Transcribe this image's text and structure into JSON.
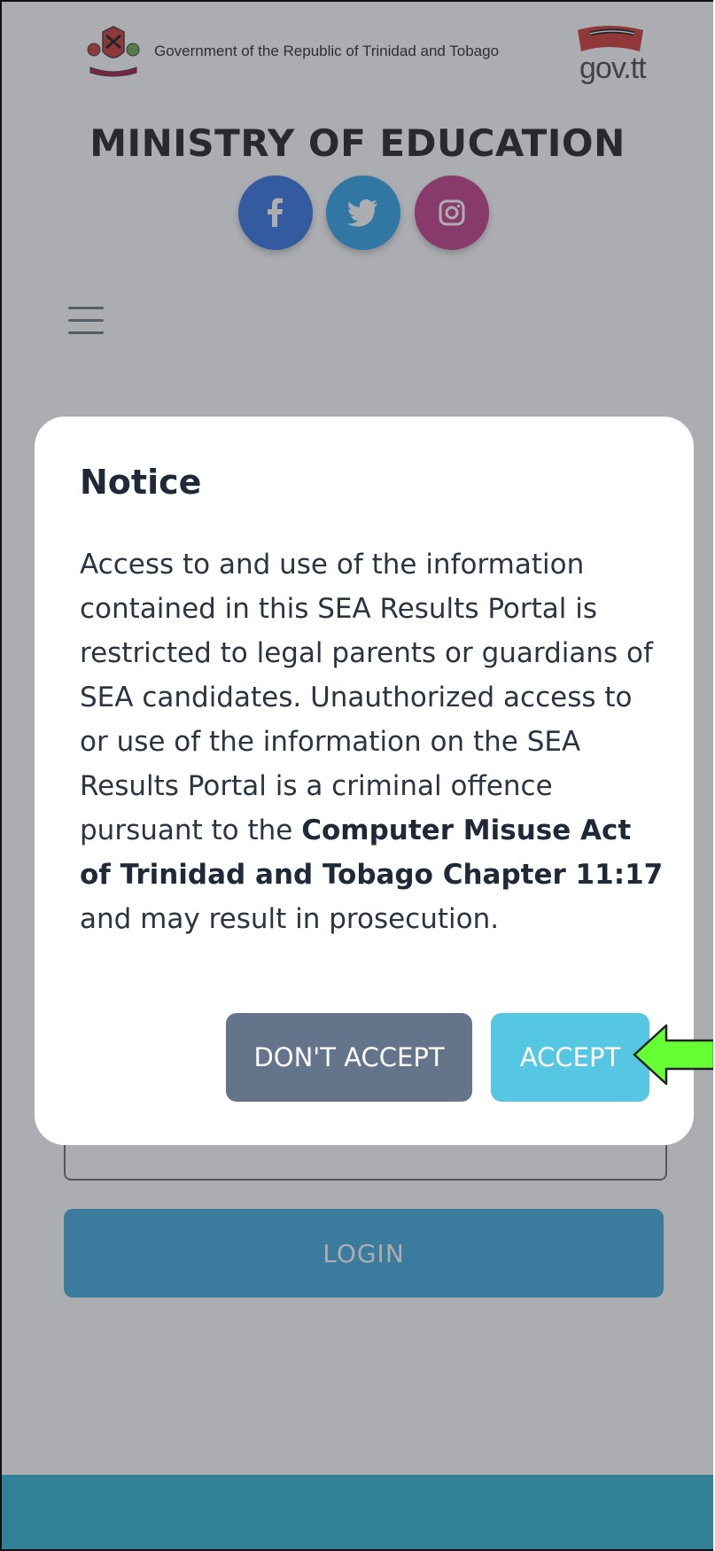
{
  "header": {
    "gov_text": "Government of the Republic of Trinidad and Tobago",
    "govtt": "gov.tt",
    "ministry": "MINISTRY OF EDUCATION",
    "social": [
      "facebook-icon",
      "twitter-icon",
      "instagram-icon"
    ]
  },
  "login_button": "LOGIN",
  "modal": {
    "title": "Notice",
    "body_plain": "Access to and use of the information contained in this SEA Results Portal is restricted to legal parents or guardians of SEA candidates. Unauthorized access to or use of the information on the SEA Results Portal is a criminal offence pursuant to the ",
    "body_bold": "Computer Misuse Act of Trinidad and Tobago Chapter 11:17",
    "body_end": " and may result in prosecution.",
    "decline": "DON'T ACCEPT",
    "accept": "ACCEPT"
  },
  "colors": {
    "facebook": "#2f6fdf",
    "twitter": "#28a3e6",
    "instagram": "#c13584",
    "decline": "#64748b",
    "accept": "#56c7e3",
    "arrow": "#66ff33"
  }
}
